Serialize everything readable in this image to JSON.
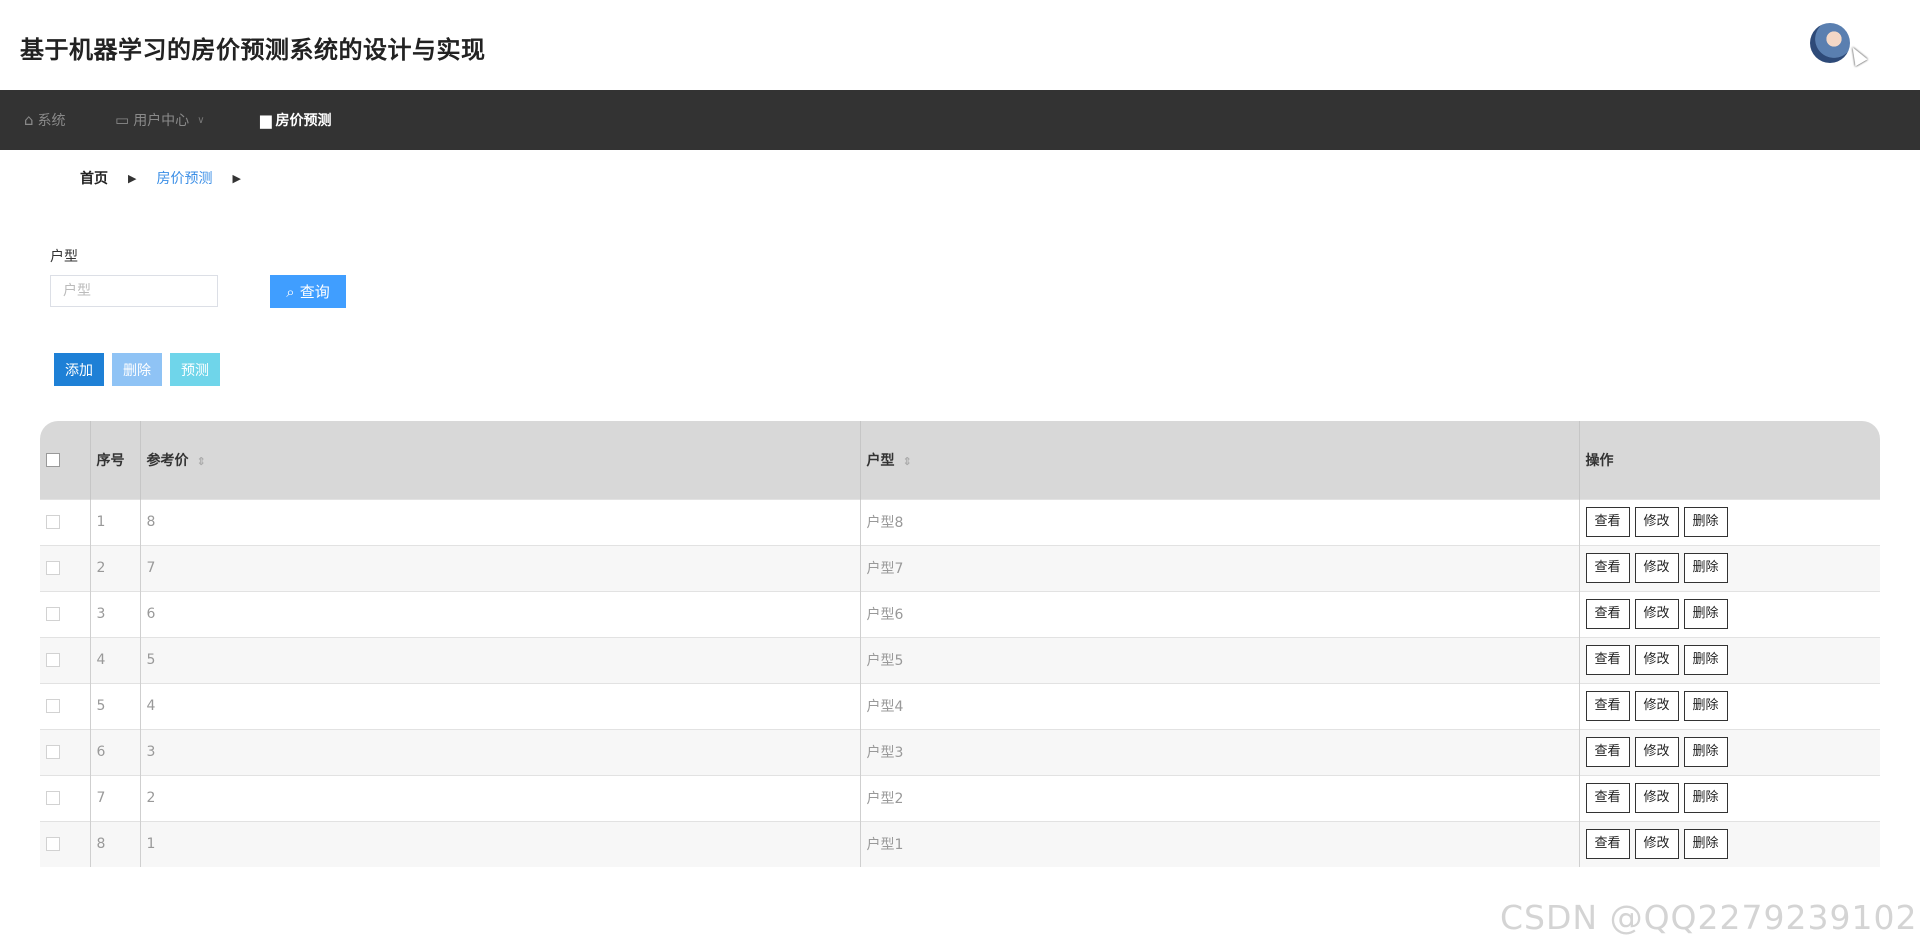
{
  "header": {
    "title": "基于机器学习的房价预测系统的设计与实现",
    "avatar_icon": "user-avatar"
  },
  "nav": {
    "items": [
      {
        "label": "系统",
        "icon": "home-icon"
      },
      {
        "label": "用户中心",
        "icon": "card-icon"
      },
      {
        "label": "房价预测",
        "icon": "house-icon"
      }
    ]
  },
  "breadcrumb": {
    "home": "首页",
    "current": "房价预测"
  },
  "search": {
    "label": "户型",
    "placeholder": "户型",
    "button_label": "查询"
  },
  "actions": {
    "add": "添加",
    "delete": "删除",
    "predict": "预测"
  },
  "table": {
    "headers": {
      "index": "序号",
      "price": "参考价",
      "type": "户型",
      "ops": "操作"
    },
    "rows": [
      {
        "index": "1",
        "price": "8",
        "type": "户型8"
      },
      {
        "index": "2",
        "price": "7",
        "type": "户型7"
      },
      {
        "index": "3",
        "price": "6",
        "type": "户型6"
      },
      {
        "index": "4",
        "price": "5",
        "type": "户型5"
      },
      {
        "index": "5",
        "price": "4",
        "type": "户型4"
      },
      {
        "index": "6",
        "price": "3",
        "type": "户型3"
      },
      {
        "index": "7",
        "price": "2",
        "type": "户型2"
      },
      {
        "index": "8",
        "price": "1",
        "type": "户型1"
      }
    ],
    "row_buttons": {
      "view": "查看",
      "edit": "修改",
      "delete": "删除"
    }
  },
  "watermark": "CSDN @QQ2279239102",
  "colors": {
    "nav_bg": "#333333",
    "primary": "#409eff",
    "add_btn": "#1e80d6"
  }
}
